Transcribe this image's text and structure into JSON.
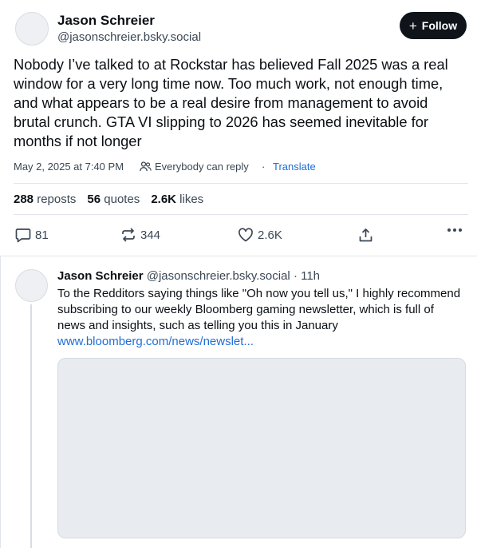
{
  "post": {
    "author_name": "Jason Schreier",
    "author_handle": "@jasonschreier.bsky.social",
    "follow_label": "Follow",
    "text": "Nobody I’ve talked to at Rockstar has believed Fall 2025 was a real window for a very long time now. Too much work, not enough time, and what appears to be a real desire from management to avoid brutal crunch. GTA VI slipping to 2026 has seemed inevitable for months if not longer",
    "date": "May 2, 2025 at 7:40 PM",
    "reply_setting": "Everybody can reply",
    "dot": "·",
    "translate_label": "Translate",
    "stats": {
      "reposts_count": "288",
      "reposts_label": "reposts",
      "quotes_count": "56",
      "quotes_label": "quotes",
      "likes_count": "2.6K",
      "likes_label": "likes"
    },
    "actions": {
      "reply_count": "81",
      "repost_count": "344",
      "like_count": "2.6K"
    }
  },
  "reply": {
    "author_name": "Jason Schreier",
    "author_handle": "@jasonschreier.bsky.social",
    "time": "· 11h",
    "text": "To the Redditors saying things like \"Oh now you tell us,\" I highly recommend subscribing to our weekly Bloomberg gaming newsletter, which is full of news and insights, such as telling you this in January",
    "link": "www.bloomberg.com/news/newslet..."
  },
  "colors": {
    "accent": "#1f6ed4",
    "text": "#0b0f14",
    "muted": "#3b4754",
    "button": "#0f141a"
  }
}
